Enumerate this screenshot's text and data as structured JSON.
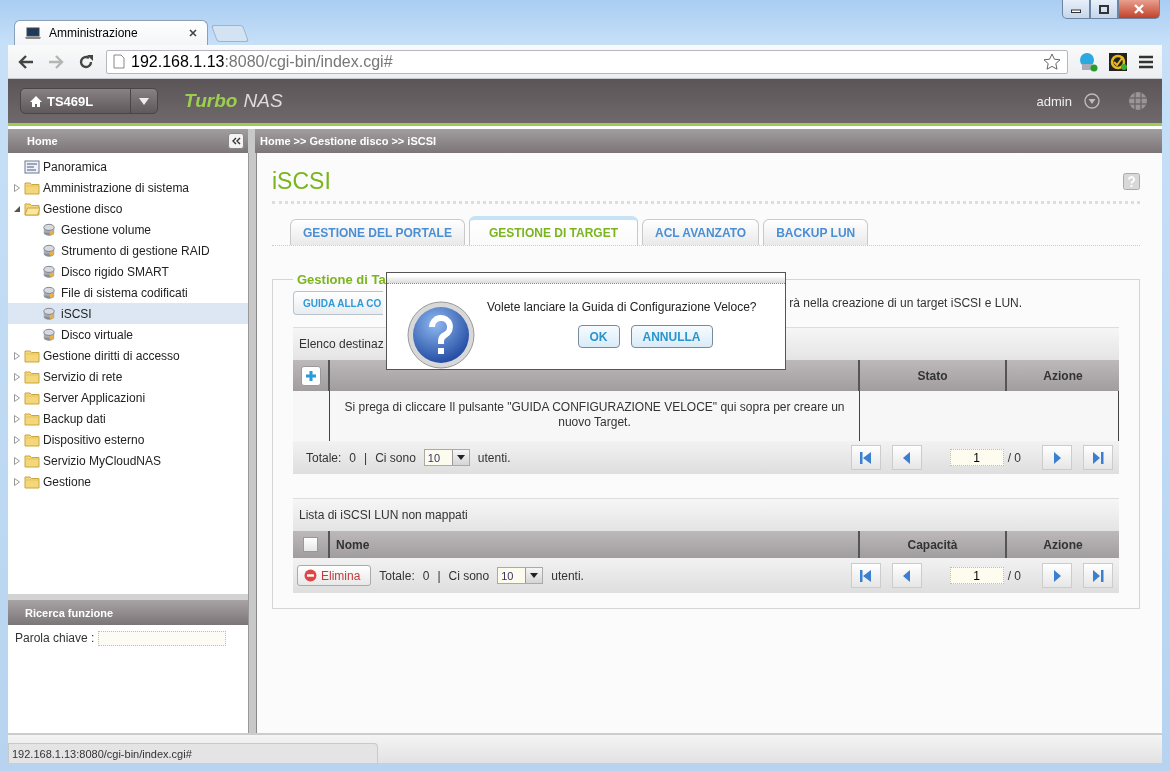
{
  "browser": {
    "tabs": [
      {
        "title": "Amministrazione",
        "selected": true
      }
    ],
    "address_host": "192.168.1.13",
    "address_rest": ":8080/cgi-bin/index.cgi#",
    "status_url": "192.168.1.13:8080/cgi-bin/index.cgi#"
  },
  "header": {
    "device": "TS469L",
    "brand_strong": "Turbo",
    "brand": "NAS",
    "user": "admin"
  },
  "sidebar": {
    "title": "Home",
    "items": [
      {
        "label": "Panoramica",
        "kind": "page",
        "selected": false
      },
      {
        "label": "Amministrazione di sistema",
        "kind": "folder",
        "expanded": false,
        "selected": false
      },
      {
        "label": "Gestione disco",
        "kind": "folder",
        "expanded": true,
        "selected": false,
        "children": [
          {
            "label": "Gestione volume",
            "kind": "tool",
            "selected": false
          },
          {
            "label": "Strumento di gestione RAID",
            "kind": "tool",
            "selected": false
          },
          {
            "label": "Disco rigido SMART",
            "kind": "tool",
            "selected": false
          },
          {
            "label": "File di sistema codificati",
            "kind": "tool",
            "selected": false
          },
          {
            "label": "iSCSI",
            "kind": "tool",
            "selected": true
          },
          {
            "label": "Disco virtuale",
            "kind": "tool",
            "selected": false
          }
        ]
      },
      {
        "label": "Gestione diritti di accesso",
        "kind": "folder",
        "expanded": false,
        "selected": false
      },
      {
        "label": "Servizio di rete",
        "kind": "folder",
        "expanded": false,
        "selected": false
      },
      {
        "label": "Server Applicazioni",
        "kind": "folder",
        "expanded": false,
        "selected": false
      },
      {
        "label": "Backup dati",
        "kind": "folder",
        "expanded": false,
        "selected": false
      },
      {
        "label": "Dispositivo esterno",
        "kind": "folder",
        "expanded": false,
        "selected": false
      },
      {
        "label": "Servizio MyCloudNAS",
        "kind": "folder",
        "expanded": false,
        "selected": false
      },
      {
        "label": "Gestione",
        "kind": "folder",
        "expanded": false,
        "selected": false
      }
    ]
  },
  "search": {
    "title": "Ricerca funzione",
    "label": "Parola chiave :"
  },
  "breadcrumb": "Home >> Gestione disco >> iSCSI",
  "page_title": "iSCSI",
  "tabs": [
    {
      "label": "GESTIONE DEL PORTALE",
      "selected": false
    },
    {
      "label": "GESTIONE DI TARGET",
      "selected": true
    },
    {
      "label": "ACL AVANZATO",
      "selected": false
    },
    {
      "label": "BACKUP LUN",
      "selected": false
    }
  ],
  "section": {
    "legend": "Gestione di Ta",
    "wizard_button": "GUIDA ALLA CO",
    "description": "rà nella creazione di un target iSCSI e LUN."
  },
  "targets": {
    "title": "Elenco destinaz",
    "columns": [
      "Stato",
      "Azione"
    ],
    "message": "Si prega di cliccare Il pulsante \"GUIDA CONFIGURAZIONE VELOCE\" qui sopra per creare un nuovo Target.",
    "total_label": "Totale:",
    "total": "0",
    "separator": "|",
    "per_page_label": "Ci sono",
    "per_page": "10",
    "unit": "utenti.",
    "page": "1",
    "pages": "/ 0"
  },
  "luns": {
    "title": "Lista di iSCSI LUN non mappati",
    "select_all": false,
    "columns": [
      "Nome",
      "Capacità",
      "Azione"
    ],
    "delete_button": "Elimina",
    "total_label": "Totale:",
    "total": "0",
    "separator": "|",
    "per_page_label": "Ci sono",
    "per_page": "10",
    "unit": "utenti.",
    "page": "1",
    "pages": "/ 0"
  },
  "dialog": {
    "message": "Volete lanciare la Guida di Configurazione Veloce?",
    "buttons": [
      "OK",
      "ANNULLA"
    ]
  }
}
